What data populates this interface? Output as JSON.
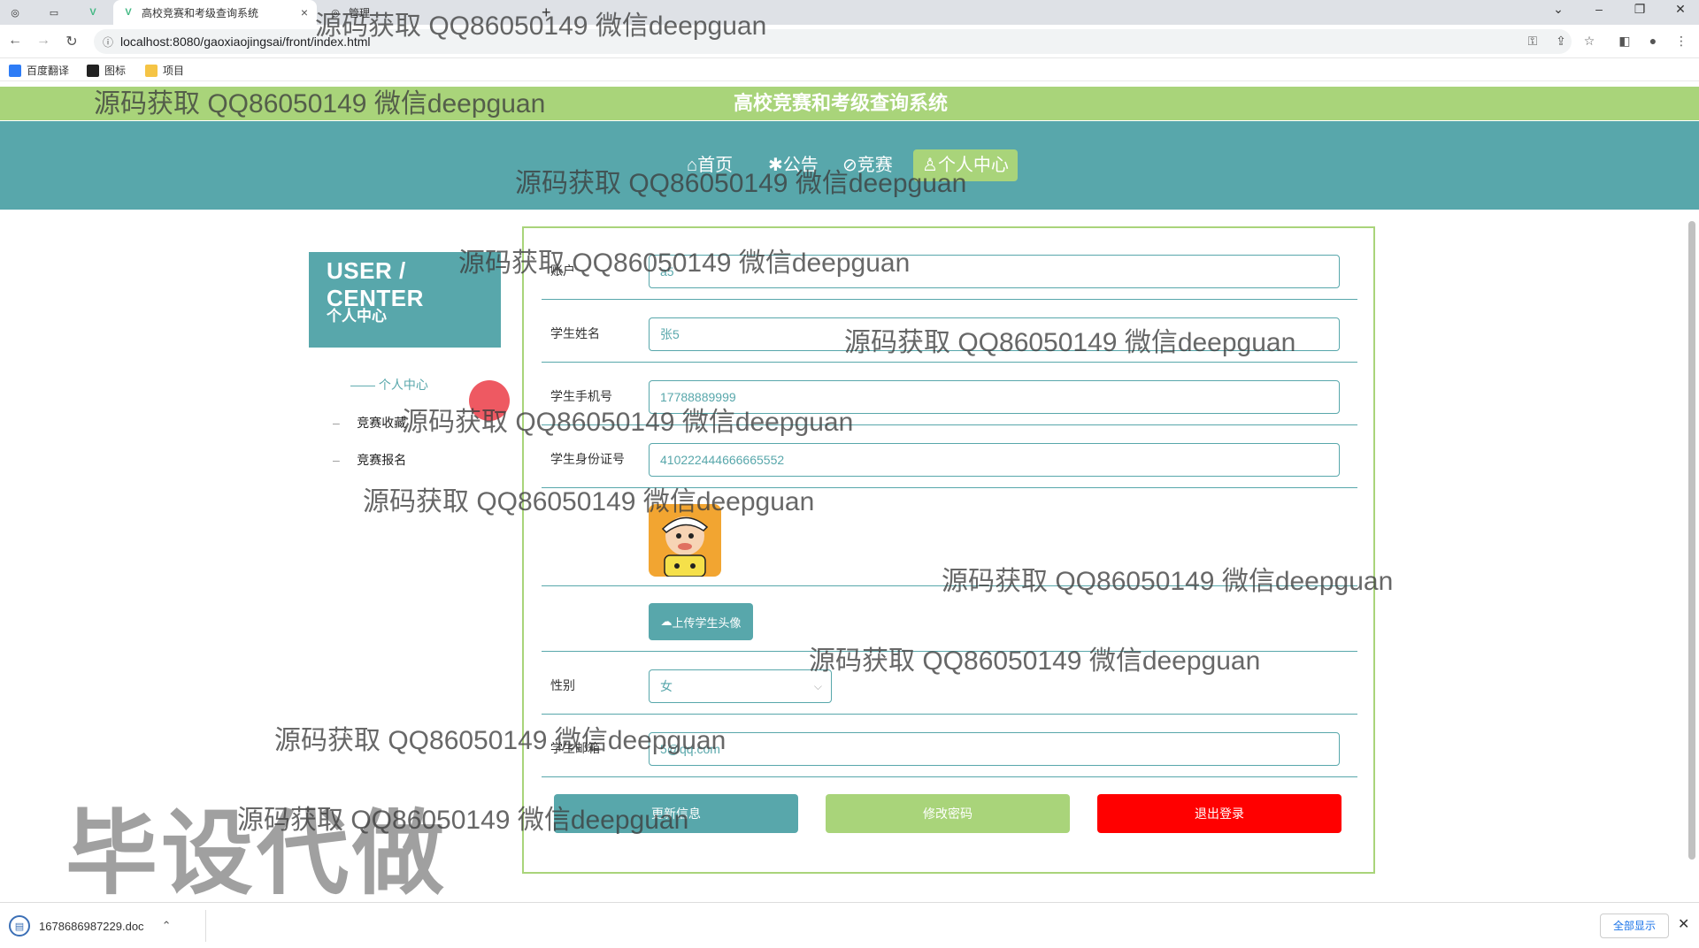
{
  "browser": {
    "tabs": [
      {
        "title": "",
        "icon": "chrome-icon"
      },
      {
        "title": "",
        "icon": "blank-page-icon"
      },
      {
        "title": "",
        "icon": "vue-icon"
      },
      {
        "title": "高校竞赛和考级查询系统",
        "icon": "vue-icon"
      },
      {
        "title": "管理",
        "icon": "chrome-icon"
      }
    ],
    "new_tab": "+",
    "url": "localhost:8080/gaoxiaojingsai/front/index.html",
    "bookmarks": [
      "百度翻译",
      "图标",
      "项目"
    ]
  },
  "site": {
    "title": "高校竞赛和考级查询系统",
    "nav": [
      {
        "label": "首页",
        "icon": "home-icon"
      },
      {
        "label": "公告",
        "icon": "gear-icon"
      },
      {
        "label": "竞赛",
        "icon": "tag-icon"
      },
      {
        "label": "个人中心",
        "icon": "user-icon",
        "active": true
      }
    ]
  },
  "sidebar": {
    "title_en": "USER / CENTER",
    "title_cn": "个人中心",
    "items": [
      {
        "label": "个人中心",
        "active": true
      },
      {
        "label": "竞赛收藏"
      },
      {
        "label": "竞赛报名"
      }
    ]
  },
  "form": {
    "account": {
      "label": "账户",
      "value": "a5"
    },
    "name": {
      "label": "学生姓名",
      "value": "张5"
    },
    "phone": {
      "label": "学生手机号",
      "value": "17788889999"
    },
    "idcard": {
      "label": "学生身份证号",
      "value": "410222444666665552"
    },
    "upload_label": "上传学生头像",
    "gender": {
      "label": "性别",
      "value": "女"
    },
    "email": {
      "label": "学生邮箱",
      "value": "5@qq.com"
    },
    "buttons": {
      "update": "更新信息",
      "change_password": "修改密码",
      "logout": "退出登录"
    }
  },
  "download": {
    "filename": "1678686987229.doc",
    "show_all": "全部显示"
  },
  "watermarks": {
    "text": "源码获取 QQ86050149 微信deepguan",
    "big": "毕设代做"
  },
  "colors": {
    "teal": "#58a7ab",
    "green": "#a9d47a",
    "red": "#ff0000"
  }
}
